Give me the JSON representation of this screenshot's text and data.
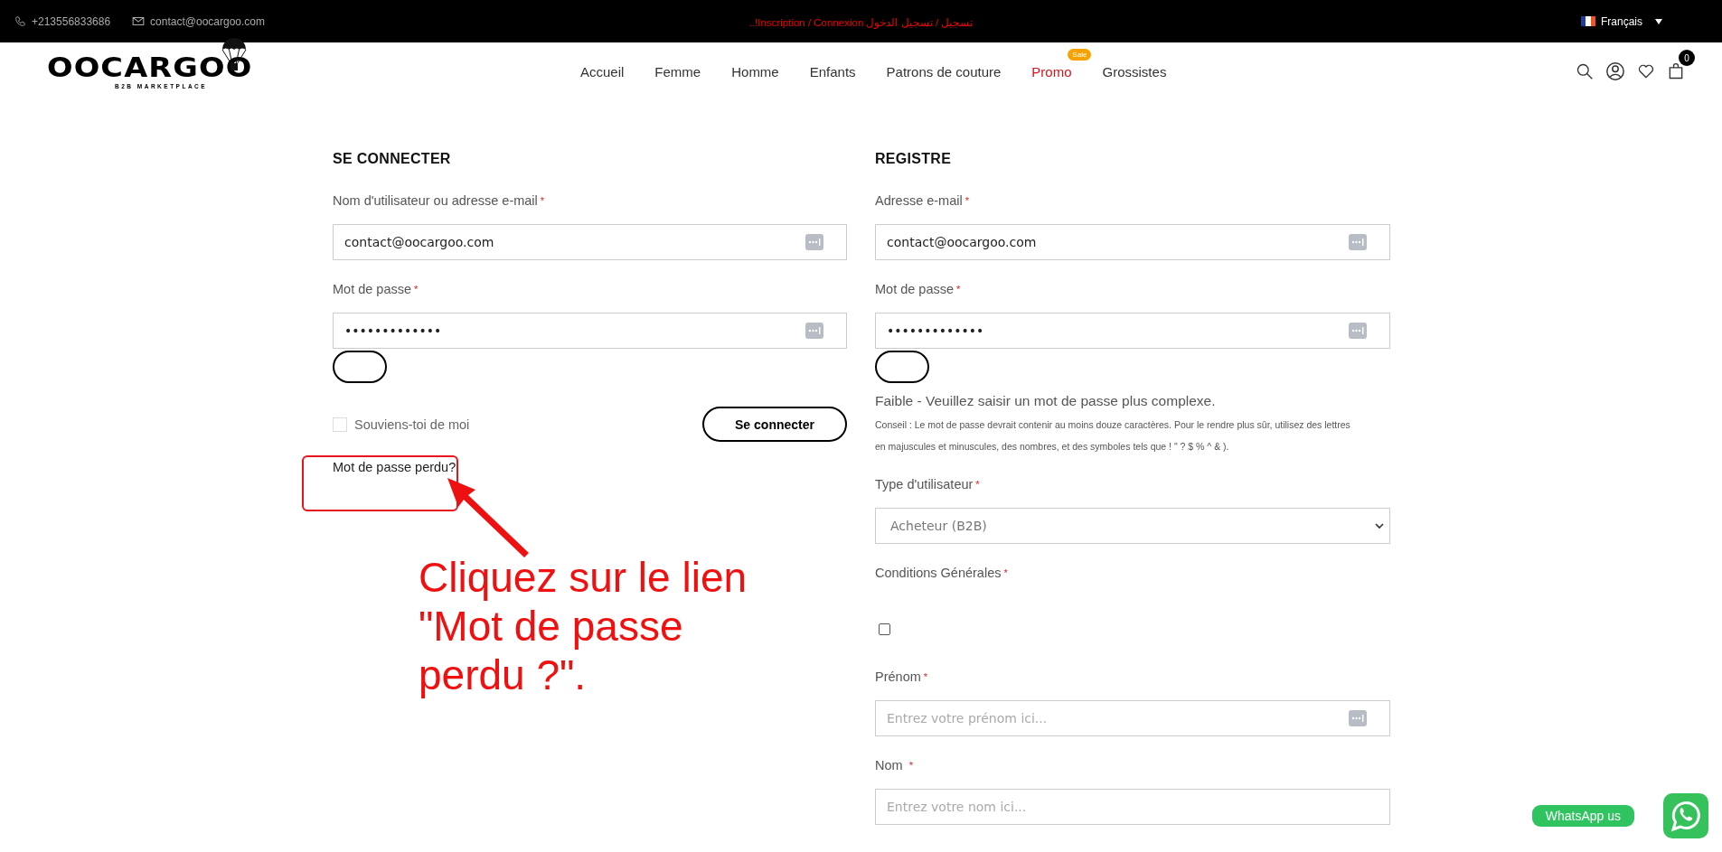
{
  "top_bar": {
    "phone": "+213556833686",
    "email": "contact@oocargoo.com",
    "announcement": "تسجيل / تسجيل الدخول Inscription / Connexion!..",
    "language": "Français"
  },
  "header": {
    "logo": {
      "name": "OOCARGOO",
      "tagline": "B2B MARKETPLACE"
    },
    "nav": [
      {
        "label": "Accueil",
        "highlighted": false
      },
      {
        "label": "Femme",
        "highlighted": false
      },
      {
        "label": "Homme",
        "highlighted": false
      },
      {
        "label": "Enfants",
        "highlighted": false
      },
      {
        "label": "Patrons de couture",
        "highlighted": false
      },
      {
        "label": "Promo",
        "highlighted": true,
        "badge": "Sale"
      },
      {
        "label": "Grossistes",
        "highlighted": false
      }
    ],
    "cart_count": "0"
  },
  "login": {
    "title": "SE CONNECTER",
    "fields": [
      {
        "kind": "text",
        "label": "Nom d'utilisateur ou adresse e-mail",
        "required_mark": "*",
        "value": "contact@oocargoo.com",
        "autofill_icon": true
      },
      {
        "kind": "password",
        "label": "Mot de passe",
        "required_mark": "*",
        "value": "•••••••••••••",
        "autofill_icon": true
      }
    ],
    "remember": {
      "label": "Souviens-toi de moi",
      "checked": false
    },
    "submit": "Se connecter",
    "lost_password": "Mot de passe perdu?"
  },
  "register": {
    "title": "REGISTRE",
    "fields": [
      {
        "kind": "text",
        "label": "Adresse e-mail",
        "required_mark": "*",
        "value": "contact@oocargoo.com",
        "autofill_icon": true
      },
      {
        "kind": "password",
        "label": "Mot de passe",
        "required_mark": "*",
        "value": "•••••••••••••",
        "autofill_icon": true
      },
      {
        "kind": "strength",
        "text": "Faible - Veuillez saisir un mot de passe plus complexe."
      },
      {
        "kind": "hint",
        "text": "Conseil : Le mot de passe devrait contenir au moins douze caractères. Pour le rendre plus sûr, utilisez des lettres en majuscules et minuscules, des nombres, et des symboles tels que ! \" ? $ % ^ & )."
      },
      {
        "kind": "select",
        "label": "Type d'utilisateur",
        "required_mark": "*",
        "value": "Acheteur (B2B)"
      },
      {
        "kind": "checkbox",
        "label": "Conditions Générales",
        "required_mark": "*",
        "checked": false
      },
      {
        "kind": "text",
        "label": "Prénom",
        "required_mark": "*",
        "placeholder": "Entrez votre prénom ici...",
        "autofill_icon": true
      },
      {
        "kind": "text",
        "label": "Nom ",
        "required_mark": "*",
        "placeholder": "Entrez votre nom ici..."
      }
    ]
  },
  "annotation": {
    "text": "Cliquez sur le lien \"Mot de passe perdu ?\"."
  },
  "whatsapp": {
    "label": "WhatsApp us"
  }
}
